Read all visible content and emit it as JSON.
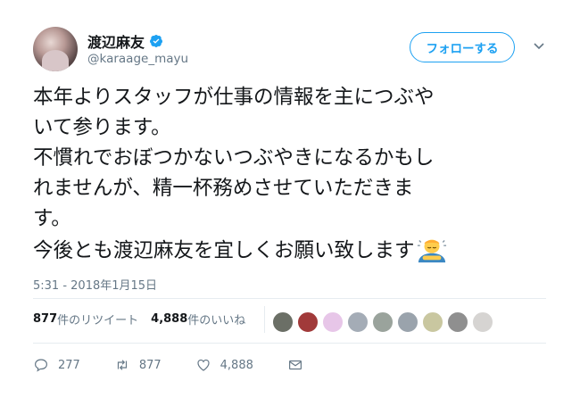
{
  "author": {
    "name": "渡辺麻友",
    "handle": "@karaage_mayu"
  },
  "follow_label": "フォローする",
  "tweet_lines": [
    "本年よりスタッフが仕事の情報を主につぶや",
    "いて参ります。",
    "不慣れでおぼつかないつぶやきになるかもし",
    "れませんが、精一杯務めさせていただきま",
    "す。",
    "今後とも渡辺麻友を宜しくお願い致します"
  ],
  "emoji": "person-bowing",
  "timestamp": "5:31 - 2018年1月15日",
  "stats": {
    "retweet_count": "877",
    "retweet_label": "件のリツイート",
    "like_count": "4,888",
    "like_label": "件のいいね"
  },
  "liker_avatar_colors": [
    "#6b6f66",
    "#a13a3a",
    "#e7c6e8",
    "#a4acb6",
    "#9aa39c",
    "#9aa3ac",
    "#c9c7a0",
    "#8f8f8f",
    "#d6d4d2"
  ],
  "actions": {
    "replies": "277",
    "retweets": "877",
    "likes": "4,888"
  },
  "colors": {
    "accent": "#1da1f2",
    "muted": "#657786",
    "text": "#14171a"
  }
}
